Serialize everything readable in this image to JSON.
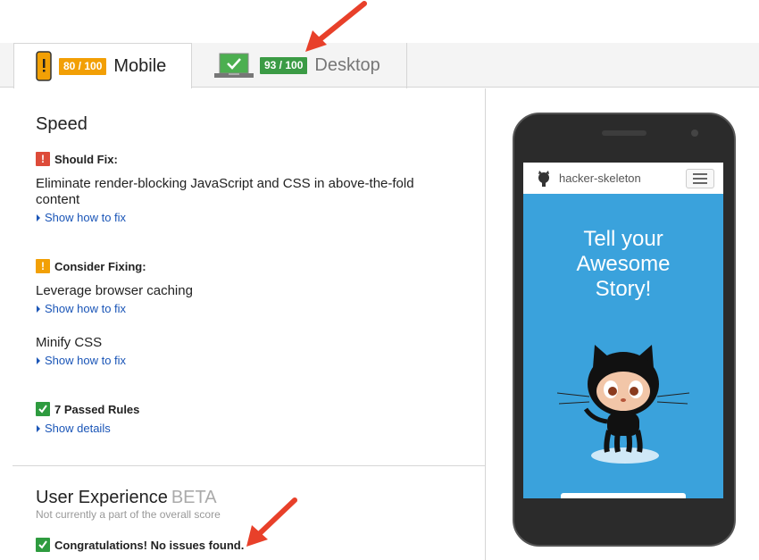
{
  "tabs": {
    "mobile": {
      "score": "80 / 100",
      "label": "Mobile"
    },
    "desktop": {
      "score": "93 / 100",
      "label": "Desktop"
    }
  },
  "speed": {
    "heading": "Speed",
    "should_fix": {
      "header": "Should Fix:",
      "rules": [
        {
          "title": "Eliminate render-blocking JavaScript and CSS in above-the-fold content",
          "link": "Show how to fix"
        }
      ]
    },
    "consider_fixing": {
      "header": "Consider Fixing:",
      "rules": [
        {
          "title": "Leverage browser caching",
          "link": "Show how to fix"
        },
        {
          "title": "Minify CSS",
          "link": "Show how to fix"
        }
      ]
    },
    "passed": {
      "header": "7 Passed Rules",
      "link": "Show details"
    }
  },
  "user_experience": {
    "heading": "User Experience",
    "beta": "BETA",
    "note": "Not currently a part of the overall score",
    "result": "Congratulations! No issues found."
  },
  "preview": {
    "site_title": "hacker-skeleton",
    "hero_lines": [
      "Tell your",
      "Awesome",
      "Story!"
    ]
  },
  "colors": {
    "accent_orange": "#f29f05",
    "accent_green": "#3b9b45",
    "error_red": "#dd4b39",
    "link_blue": "#1a55b7",
    "preview_blue": "#3aa2dc",
    "arrow_red": "#e8402a"
  },
  "icons": {
    "mobile_tab": "phone-warning-icon",
    "desktop_tab": "laptop-check-icon",
    "should_fix": "exclamation-icon",
    "consider_fixing": "exclamation-icon",
    "passed": "checkmark-icon",
    "menu": "hamburger-icon"
  }
}
